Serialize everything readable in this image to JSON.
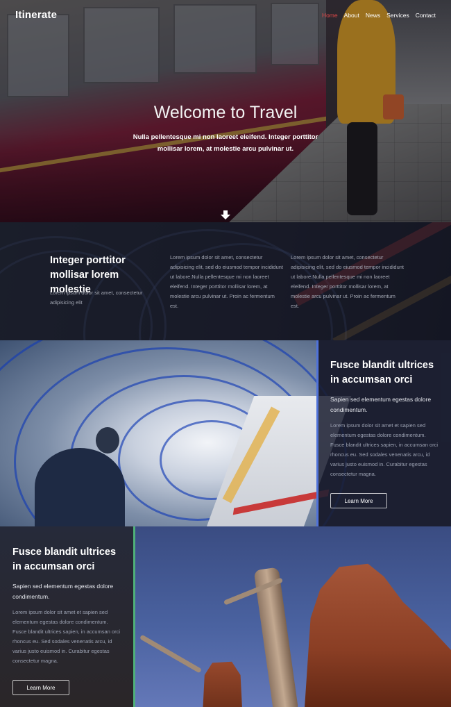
{
  "nav": {
    "logo": "Itinerate",
    "items": [
      {
        "label": "Home",
        "active": true
      },
      {
        "label": "About"
      },
      {
        "label": "News"
      },
      {
        "label": "Services"
      },
      {
        "label": "Contact"
      }
    ]
  },
  "hero": {
    "title": "Welcome to Travel",
    "subtitle": "Nulla pellentesque mi non laoreet eleifend. Integer porttitor mollisar lorem, at molestie arcu pulvinar ut.",
    "arrow_icon": "arrow-down-icon"
  },
  "section2": {
    "heading": "Integer porttitor mollisar lorem molestie",
    "small": "Lorem ipsum dolor sit amet, consectetur adipisicing elit",
    "col1": "Lorem ipsum dolor sit amet, consectetur adipisicing elit, sed do eiusmod tempor incididunt ut labore.Nulla pellentesque mi non laoreet eleifend. Integer porttitor mollisar lorem, at molestie arcu pulvinar ut. Proin ac fermentum est.",
    "col2": "Lorem ipsum dolor sit amet, consectetur adipisicing elit, sed do eiusmod tempor incididunt ut labore.Nulla pellentesque mi non laoreet eleifend. Integer porttitor mollisar lorem, at molestie arcu pulvinar ut. Proin ac fermentum est."
  },
  "section3": {
    "heading": "Fusce blandit ultrices in accumsan orci",
    "subheading": "Sapien sed elementum egestas dolore condimentum.",
    "body": "Lorem ipsum dolor sit amet et sapien sed elementum egestas dolore condimentum. Fusce blandit ultrices sapien, in accumsan orci rhoncus eu. Sed sodales venenatis arcu, id varius justo euismod in. Curabitur egestas consectetur magna.",
    "button": "Learn More",
    "accent": "#4f72d9"
  },
  "section4": {
    "heading": "Fusce blandit ultrices in accumsan orci",
    "subheading": "Sapien sed elementum egestas dolore condimentum.",
    "body": "Lorem ipsum dolor sit amet et sapien sed elementum egestas dolore condimentum. Fusce blandit ultrices sapien, in accumsan orci rhoncus eu. Sed sodales venenatis arcu, id varius justo euismod in. Curabitur egestas consectetur magna.",
    "button": "Learn More",
    "accent": "#4fb078"
  }
}
